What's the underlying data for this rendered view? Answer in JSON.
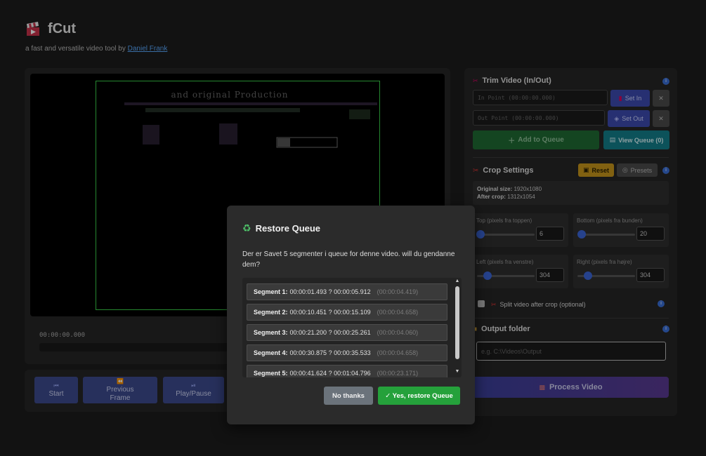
{
  "app": {
    "title": "fCut",
    "tagline_prefix": "a fast and versatile video tool by ",
    "author": "Daniel Frank"
  },
  "player": {
    "timecode": "00:00:00.000",
    "frame_text": "and original Production"
  },
  "controls": [
    {
      "label": "Start",
      "icon": "skip-start-icon"
    },
    {
      "label": "Previous Frame",
      "icon": "previous-frame-icon"
    },
    {
      "label": "Play/Pause",
      "icon": "play-pause-icon"
    }
  ],
  "trim": {
    "title": "Trim Video (In/Out)",
    "in_placeholder": "In Point (00:00:00.000)",
    "out_placeholder": "Out Point (00:00:00.000)",
    "set_in": "Set In",
    "set_out": "Set Out",
    "add_queue": "Add to Queue",
    "view_queue": "View Queue (0)"
  },
  "crop": {
    "title": "Crop Settings",
    "reset": "Reset",
    "presets": "Presets",
    "original_label": "Original size:",
    "original_value": "1920x1080",
    "after_label": "After crop:",
    "after_value": "1312x1054",
    "top_label": "Top (pixels fra toppen)",
    "top_value": "6",
    "bottom_label": "Bottom (pixels fra bunden)",
    "bottom_value": "20",
    "left_label": "Left (pixels fra venstre)",
    "left_value": "304",
    "right_label": "Right (pixels fra højre)",
    "right_value": "304",
    "split_label": "Split video after crop (optional)"
  },
  "output": {
    "title": "Output folder",
    "placeholder": "e.g. C:\\Videos\\Output"
  },
  "process_label": "Process Video",
  "modal": {
    "title": "Restore Queue",
    "message": "Der er Savet 5 segmenter i queue for denne video. will du gendanne dem?",
    "segments": [
      {
        "label": "Segment 1:",
        "range": "00:00:01.493 ? 00:00:05.912",
        "duration": "(00:00:04.419)"
      },
      {
        "label": "Segment 2:",
        "range": "00:00:10.451 ? 00:00:15.109",
        "duration": "(00:00:04.658)"
      },
      {
        "label": "Segment 3:",
        "range": "00:00:21.200 ? 00:00:25.261",
        "duration": "(00:00:04.060)"
      },
      {
        "label": "Segment 4:",
        "range": "00:00:30.875 ? 00:00:35.533",
        "duration": "(00:00:04.658)"
      },
      {
        "label": "Segment 5:",
        "range": "00:00:41.624 ? 00:01:04.796",
        "duration": "(00:00:23.171)"
      }
    ],
    "no_label": "No thanks",
    "yes_label": "✓ Yes, restore Queue"
  },
  "colors": {
    "accent_blue": "#3d4ab0",
    "accent_green": "#25a13b",
    "accent_teal": "#137e8b",
    "accent_yellow": "#c6951b"
  }
}
